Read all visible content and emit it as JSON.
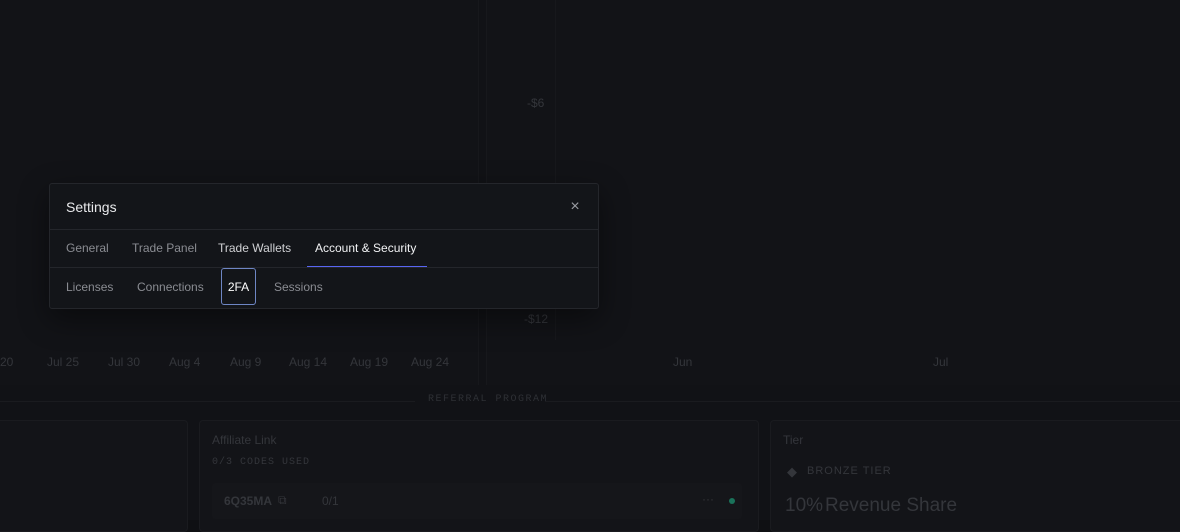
{
  "background": {
    "x_ticks_left": [
      "20",
      "Jul 25",
      "Jul 30",
      "Aug 4",
      "Aug 9",
      "Aug 14",
      "Aug 19",
      "Aug 24"
    ],
    "x_ticks_right": [
      "Jun",
      "Jul"
    ],
    "y_ticks_right": [
      "-$6",
      "-$12"
    ],
    "section_label": "REFERRAL PROGRAM",
    "affiliate": {
      "title": "Affiliate Link",
      "codes_used": "0/3 CODES USED",
      "code": "6Q35MA",
      "usage": "0/1"
    },
    "tier": {
      "title": "Tier",
      "tier_name": "BRONZE TIER",
      "revenue_prefix": "10%",
      "revenue_label": "Revenue Share"
    }
  },
  "modal": {
    "title": "Settings",
    "close_label": "×",
    "tabs": [
      {
        "label": "General"
      },
      {
        "label": "Trade Panel"
      },
      {
        "label": "Trade Wallets"
      },
      {
        "label": "Account & Security"
      }
    ],
    "subtabs": [
      {
        "label": "Licenses"
      },
      {
        "label": "Connections"
      },
      {
        "label": "2FA"
      },
      {
        "label": "Sessions"
      }
    ]
  },
  "colors": {
    "accent": "#5865f2",
    "active_subtab_border": "#6e86c4",
    "status_dot": "#1fbf8f"
  }
}
